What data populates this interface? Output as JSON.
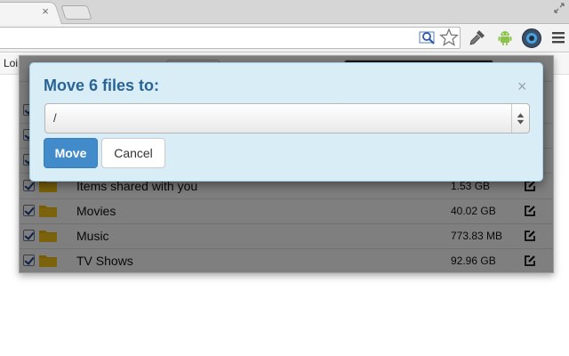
{
  "browser": {
    "tab_close": "×",
    "page_strip_label": "Loi"
  },
  "popup": {
    "files": [
      {
        "name": "",
        "size": "",
        "checked": true
      },
      {
        "name": "",
        "size": "",
        "checked": true
      },
      {
        "name": "",
        "size": "",
        "checked": true
      },
      {
        "name": "Items shared with you",
        "size": "1.53 GB",
        "checked": true
      },
      {
        "name": "Movies",
        "size": "40.02 GB",
        "checked": true
      },
      {
        "name": "Music",
        "size": "773.83 MB",
        "checked": true
      },
      {
        "name": "TV Shows",
        "size": "92.96 GB",
        "checked": true
      }
    ],
    "icons": {
      "folder": "folder-icon",
      "edit": "edit-icon",
      "checkbox": "checkbox"
    }
  },
  "modal": {
    "title": "Move 6 files to:",
    "close_glyph": "×",
    "destination_value": "/",
    "move_label": "Move",
    "cancel_label": "Cancel"
  },
  "colors": {
    "modal_bg": "#d9edf7",
    "modal_title": "#2a6496",
    "primary_button": "#428bca",
    "folder": "#f0b400",
    "android": "#8bc34a"
  }
}
